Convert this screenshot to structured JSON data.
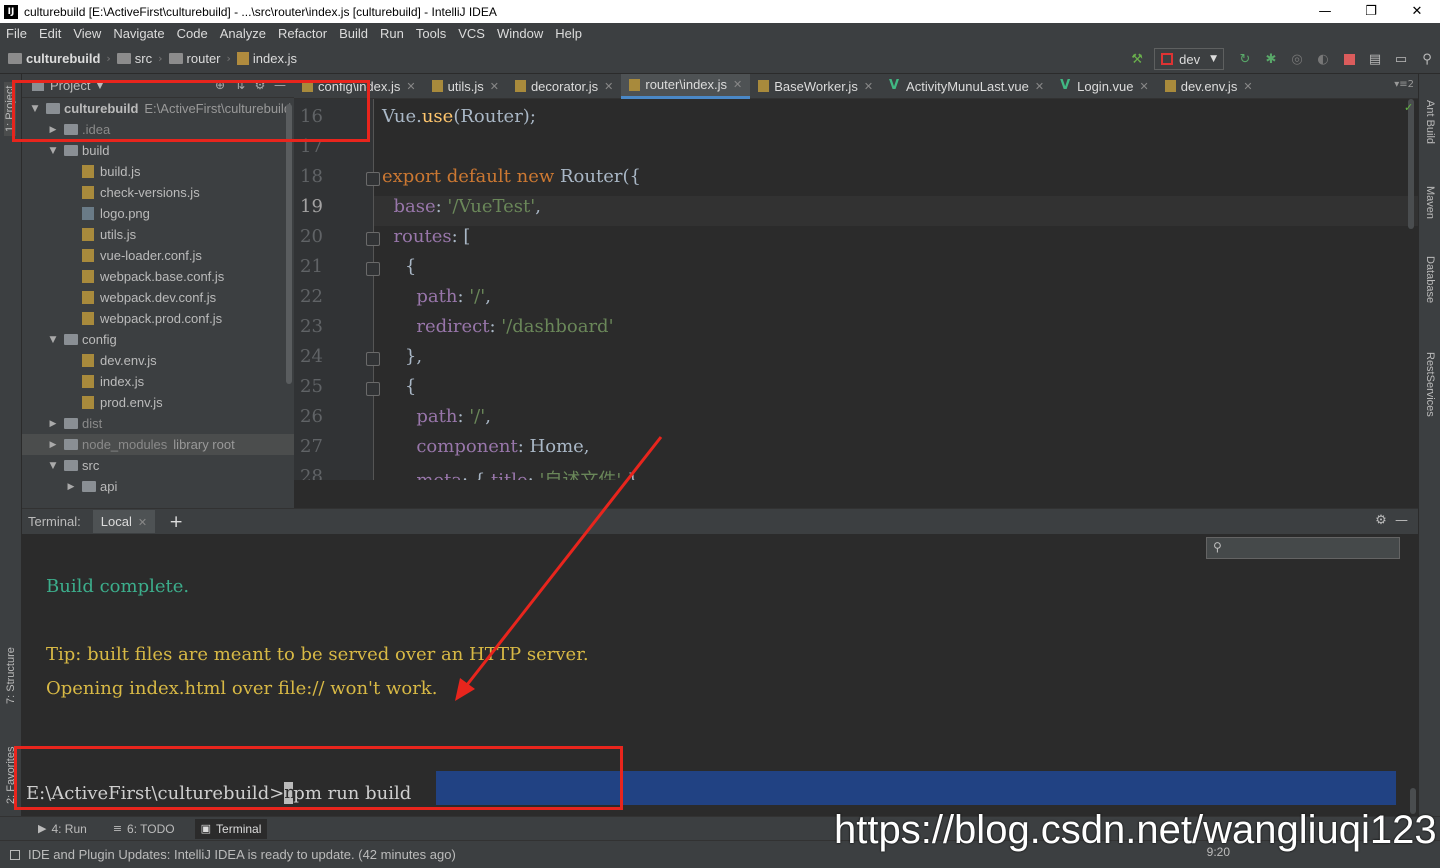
{
  "window": {
    "title": "culturebuild [E:\\ActiveFirst\\culturebuild] - ...\\src\\router\\index.js [culturebuild] - IntelliJ IDEA",
    "app_icon": "IJ",
    "controls": [
      "—",
      "❐",
      "✕"
    ]
  },
  "menu": [
    "File",
    "Edit",
    "View",
    "Navigate",
    "Code",
    "Analyze",
    "Refactor",
    "Build",
    "Run",
    "Tools",
    "VCS",
    "Window",
    "Help"
  ],
  "breadcrumbs": [
    "culturebuild",
    "src",
    "router",
    "index.js"
  ],
  "toolbar": {
    "run_config": "dev"
  },
  "left_stripe": {
    "project": "1: Project",
    "structure": "7: Structure",
    "favorites": "2: Favorites"
  },
  "right_stripe": [
    "Ant Build",
    "Maven",
    "Database",
    "RestServices"
  ],
  "project_panel": {
    "header": "Project",
    "tree": [
      {
        "label": "culturebuild",
        "extra": "E:\\ActiveFirst\\culturebuild",
        "type": "root",
        "level": 0,
        "expanded": true
      },
      {
        "label": ".idea",
        "type": "folder",
        "level": 1,
        "expanded": false
      },
      {
        "label": "build",
        "type": "folder",
        "level": 1,
        "expanded": true
      },
      {
        "label": "build.js",
        "type": "js",
        "level": 2
      },
      {
        "label": "check-versions.js",
        "type": "js",
        "level": 2
      },
      {
        "label": "logo.png",
        "type": "png",
        "level": 2
      },
      {
        "label": "utils.js",
        "type": "js",
        "level": 2
      },
      {
        "label": "vue-loader.conf.js",
        "type": "js",
        "level": 2
      },
      {
        "label": "webpack.base.conf.js",
        "type": "js",
        "level": 2
      },
      {
        "label": "webpack.dev.conf.js",
        "type": "js",
        "level": 2
      },
      {
        "label": "webpack.prod.conf.js",
        "type": "js",
        "level": 2
      },
      {
        "label": "config",
        "type": "folder",
        "level": 1,
        "expanded": true
      },
      {
        "label": "dev.env.js",
        "type": "js",
        "level": 2
      },
      {
        "label": "index.js",
        "type": "js",
        "level": 2
      },
      {
        "label": "prod.env.js",
        "type": "js",
        "level": 2
      },
      {
        "label": "dist",
        "type": "folder",
        "level": 1,
        "expanded": false
      },
      {
        "label": "node_modules",
        "extra": "library root",
        "type": "folder",
        "level": 1,
        "expanded": false,
        "selected": true
      },
      {
        "label": "src",
        "type": "folder",
        "level": 1,
        "expanded": true
      },
      {
        "label": "api",
        "type": "folder",
        "level": 2,
        "expanded": false
      }
    ]
  },
  "editor_tabs": [
    {
      "label": "config\\index.js",
      "kind": "js"
    },
    {
      "label": "utils.js",
      "kind": "js"
    },
    {
      "label": "decorator.js",
      "kind": "js"
    },
    {
      "label": "router\\index.js",
      "kind": "js",
      "active": true
    },
    {
      "label": "BaseWorker.js",
      "kind": "js"
    },
    {
      "label": "ActivityMunuLast.vue",
      "kind": "vue"
    },
    {
      "label": "Login.vue",
      "kind": "vue"
    },
    {
      "label": "dev.env.js",
      "kind": "js"
    }
  ],
  "editor_tabs_more": "▾≡2",
  "editor": {
    "current_line": "19",
    "lines": [
      {
        "n": "16",
        "html": "Vue.<span class=\"prop\" style=\"color:#ffc66d\">use</span>(Router);"
      },
      {
        "n": "17",
        "html": ""
      },
      {
        "n": "18",
        "html": "<span class=\"kw\">export default new </span>Router({"
      },
      {
        "n": "19",
        "html": "  <span class=\"prop\">base</span>: <span class=\"str\">'/VueTest'</span>,"
      },
      {
        "n": "20",
        "html": "  <span class=\"prop\">routes</span>: ["
      },
      {
        "n": "21",
        "html": "    {"
      },
      {
        "n": "22",
        "html": "      <span class=\"prop\">path</span>: <span class=\"str\">'/'</span>,"
      },
      {
        "n": "23",
        "html": "      <span class=\"prop\">redirect</span>: <span class=\"str\">'/dashboard'</span>"
      },
      {
        "n": "24",
        "html": "    },"
      },
      {
        "n": "25",
        "html": "    {"
      },
      {
        "n": "26",
        "html": "      <span class=\"prop\">path</span>: <span class=\"str\">'/'</span>,"
      },
      {
        "n": "27",
        "html": "      <span class=\"prop\">component</span>: Home,"
      },
      {
        "n": "28",
        "html": "      <span class=\"prop\">meta</span>: { <span class=\"prop\">title</span>: <span class=\"str\">'自述文件'</span> }"
      }
    ]
  },
  "terminal": {
    "label": "Terminal:",
    "tab": "Local",
    "lines": [
      {
        "text": "Build complete.",
        "color": "green"
      },
      {
        "text": "",
        "color": "yellow"
      },
      {
        "text": "Tip: built files are meant to be served over an HTTP server.",
        "color": "yellow"
      },
      {
        "text": "Opening index.html over file:// won't work.",
        "color": "yellow"
      }
    ],
    "prompt": "E:\\ActiveFirst\\culturebuild>",
    "command_first_char": "n",
    "command_rest": "pm run build"
  },
  "bottom_tools": [
    {
      "label": "4: Run",
      "glyph": "▶"
    },
    {
      "label": "6: TODO",
      "glyph": "≡"
    },
    {
      "label": "Terminal",
      "glyph": "▣",
      "active": true
    }
  ],
  "status": {
    "message": "IDE and Plugin Updates: IntelliJ IDEA is ready to update. (42 minutes ago)",
    "position": "9:20"
  },
  "watermark": "https://blog.csdn.net/wangliuqi123",
  "colors": {
    "annotation": "#e8251d",
    "selection": "#214283",
    "accent": "#4a88c7"
  }
}
